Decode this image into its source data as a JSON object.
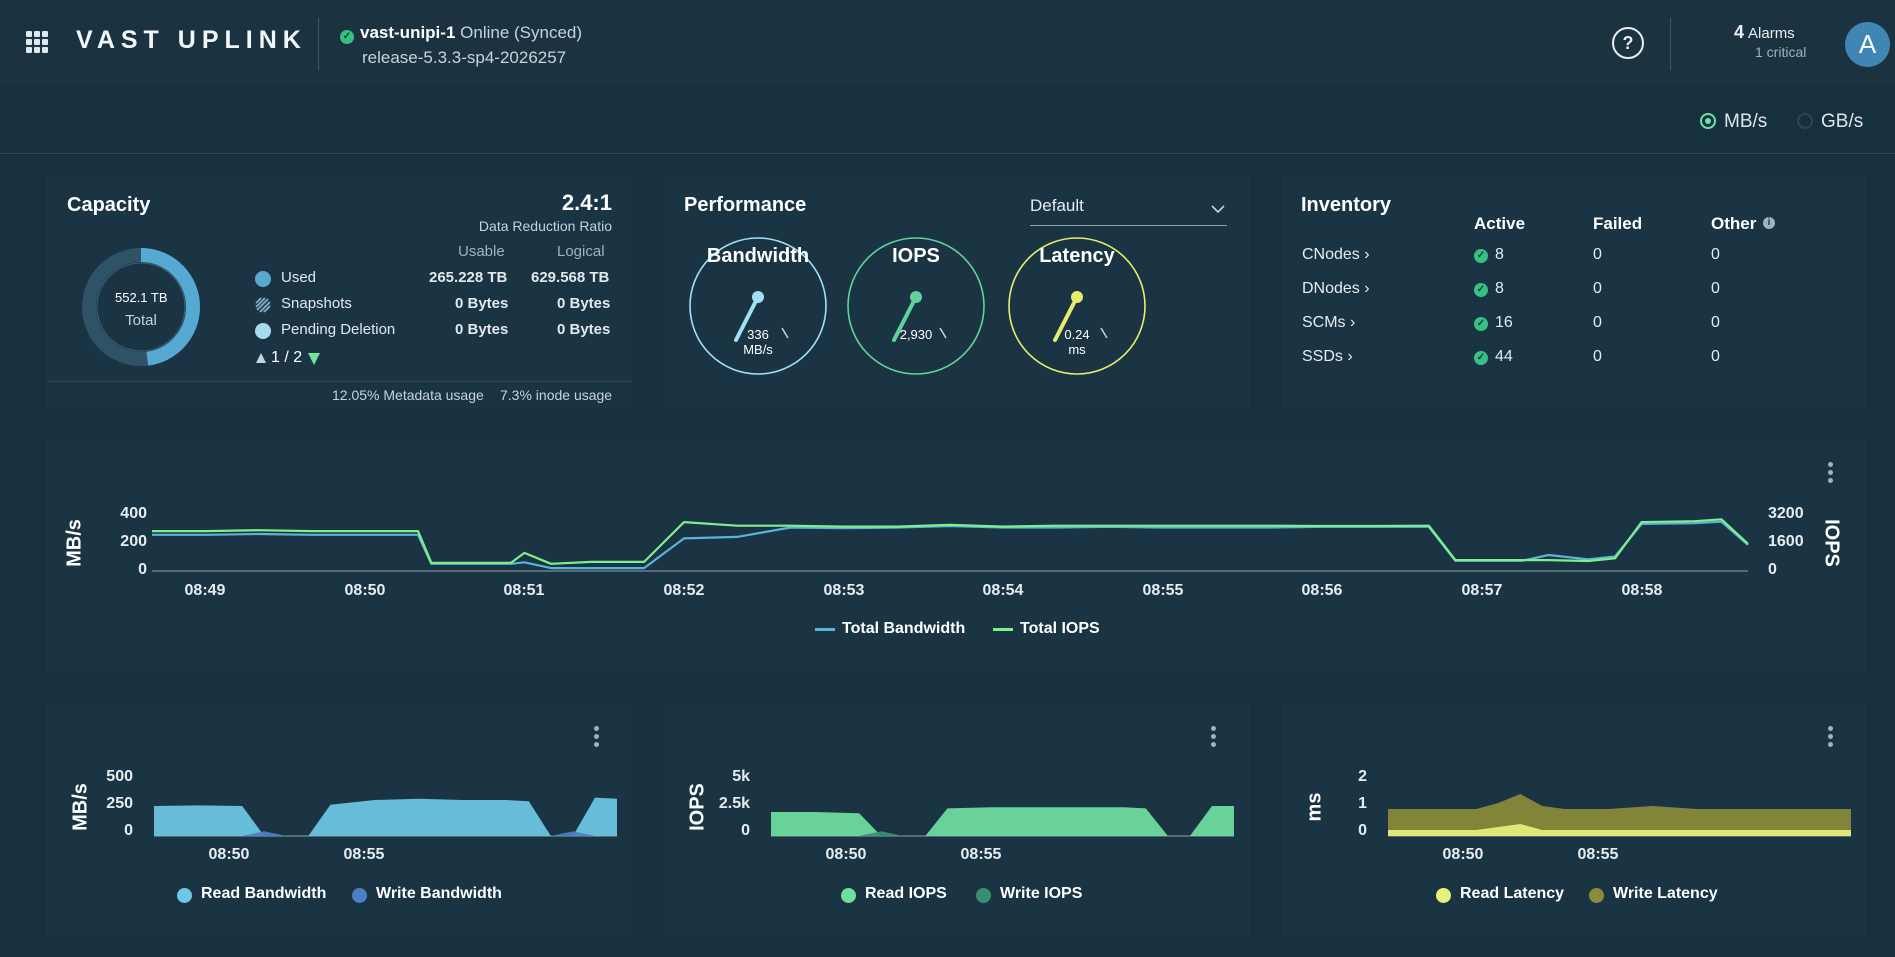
{
  "header": {
    "logo": "VAST UPLINK",
    "system_name": "vast-unipi-1",
    "system_state": "Online (Synced)",
    "release": "release-5.3.3-sp4-2026257",
    "help_label": "?",
    "alarm_count": "4",
    "alarm_label": "Alarms",
    "alarm_critical": "1 critical",
    "avatar": "A"
  },
  "units": {
    "option_mbs": "MB/s",
    "option_gbs": "GB/s",
    "selected": "MB/s"
  },
  "capacity": {
    "title": "Capacity",
    "total_value": "552.1 TB",
    "total_label": "Total",
    "drr_value": "2.4:1",
    "drr_label": "Data Reduction Ratio",
    "col_usable": "Usable",
    "col_logical": "Logical",
    "rows": [
      {
        "label": "Used",
        "usable": "265.228 TB",
        "logical": "629.568 TB"
      },
      {
        "label": "Snapshots",
        "usable": "0 Bytes",
        "logical": "0 Bytes"
      },
      {
        "label": "Pending Deletion",
        "usable": "0 Bytes",
        "logical": "0 Bytes"
      }
    ],
    "pager": "1 / 2",
    "metadata_usage": "12.05% Metadata usage",
    "inode_usage": "7.3% inode usage",
    "used_fraction": 0.48
  },
  "performance": {
    "title": "Performance",
    "dropdown_value": "Default",
    "gauges": [
      {
        "label": "Bandwidth",
        "value": "336",
        "unit": "MB/s",
        "color": "#9fe0f5"
      },
      {
        "label": "IOPS",
        "value": "2,930",
        "unit": "",
        "color": "#5fd39a"
      },
      {
        "label": "Latency",
        "value": "0.24",
        "unit": "ms",
        "color": "#e4ee6c"
      }
    ]
  },
  "inventory": {
    "title": "Inventory",
    "headers": [
      "Active",
      "Failed",
      "Other"
    ],
    "rows": [
      {
        "name": "CNodes ›",
        "active": "8",
        "failed": "0",
        "other": "0"
      },
      {
        "name": "DNodes ›",
        "active": "8",
        "failed": "0",
        "other": "0"
      },
      {
        "name": "SCMs ›",
        "active": "16",
        "failed": "0",
        "other": "0"
      },
      {
        "name": "SSDs ›",
        "active": "44",
        "failed": "0",
        "other": "0"
      }
    ]
  },
  "main_chart": {
    "ylabel_left": "MB/s",
    "ylabel_right": "IOPS",
    "yticks_left": [
      "400",
      "200",
      "0"
    ],
    "yticks_right": [
      "3200",
      "1600",
      "0"
    ],
    "xticks": [
      "08:49",
      "08:50",
      "08:51",
      "08:52",
      "08:53",
      "08:54",
      "08:55",
      "08:56",
      "08:57",
      "08:58"
    ],
    "legend": [
      "Total Bandwidth",
      "Total IOPS"
    ],
    "colors": {
      "bandwidth": "#5ab4d6",
      "iops": "#7ef08a"
    }
  },
  "small_charts": [
    {
      "ylabel": "MB/s",
      "yticks": [
        "500",
        "250",
        "0"
      ],
      "xticks": [
        "08:50",
        "08:55"
      ],
      "legend": [
        "Read Bandwidth",
        "Write Bandwidth"
      ],
      "colors": [
        "#6dc8e6",
        "#4d7fc4"
      ]
    },
    {
      "ylabel": "IOPS",
      "yticks": [
        "5k",
        "2.5k",
        "0"
      ],
      "xticks": [
        "08:50",
        "08:55"
      ],
      "legend": [
        "Read IOPS",
        "Write IOPS"
      ],
      "colors": [
        "#6fe0a0",
        "#3a8f72"
      ]
    },
    {
      "ylabel": "ms",
      "yticks": [
        "2",
        "1",
        "0"
      ],
      "xticks": [
        "08:50",
        "08:55"
      ],
      "legend": [
        "Read Latency",
        "Write Latency"
      ],
      "colors": [
        "#e9f07a",
        "#8b8b3a"
      ]
    }
  ],
  "chart_data": [
    {
      "type": "line",
      "x": [
        "08:48:40",
        "08:49:00",
        "08:49:20",
        "08:49:40",
        "08:50:00",
        "08:50:20",
        "08:50:25",
        "08:50:40",
        "08:50:55",
        "08:51:00",
        "08:51:10",
        "08:51:25",
        "08:51:35",
        "08:51:45",
        "08:52:00",
        "08:52:20",
        "08:52:40",
        "08:53:00",
        "08:53:20",
        "08:53:40",
        "08:54:00",
        "08:54:20",
        "08:54:40",
        "08:55:00",
        "08:55:20",
        "08:55:40",
        "08:56:00",
        "08:56:20",
        "08:56:40",
        "08:56:50",
        "08:57:00",
        "08:57:15",
        "08:57:25",
        "08:57:40",
        "08:57:50",
        "08:58:00",
        "08:58:20",
        "08:58:30",
        "08:58:40"
      ],
      "series": [
        {
          "name": "Total Bandwidth",
          "axis": "left",
          "values": [
            250,
            250,
            255,
            250,
            250,
            250,
            50,
            50,
            50,
            60,
            20,
            20,
            20,
            20,
            225,
            235,
            300,
            295,
            300,
            310,
            300,
            300,
            305,
            300,
            300,
            300,
            305,
            305,
            305,
            70,
            70,
            70,
            110,
            80,
            100,
            325,
            330,
            340,
            180
          ]
        },
        {
          "name": "Total IOPS",
          "axis": "right",
          "values": [
            2200,
            2200,
            2250,
            2200,
            2200,
            2200,
            450,
            450,
            450,
            1000,
            400,
            500,
            500,
            500,
            2700,
            2500,
            2500,
            2450,
            2450,
            2550,
            2450,
            2500,
            2500,
            2500,
            2500,
            2500,
            2480,
            2480,
            2500,
            600,
            600,
            600,
            600,
            550,
            700,
            2700,
            2750,
            2850,
            1500
          ]
        }
      ],
      "ylim_left": [
        0,
        400
      ],
      "ylim_right": [
        0,
        3200
      ],
      "ylabel": "MB/s",
      "ylabel_right": "IOPS",
      "grid": false,
      "legend": "bottom"
    },
    {
      "type": "area",
      "x": [
        "08:48",
        "08:49",
        "08:50",
        "08:50:30",
        "08:51",
        "08:51:30",
        "08:52",
        "08:53",
        "08:54",
        "08:55",
        "08:56",
        "08:56:30",
        "08:57",
        "08:57:30",
        "08:58",
        "08:58:30"
      ],
      "series": [
        {
          "name": "Read Bandwidth",
          "values": [
            250,
            255,
            250,
            0,
            0,
            0,
            260,
            300,
            310,
            300,
            300,
            290,
            0,
            0,
            320,
            310
          ]
        },
        {
          "name": "Write Bandwidth",
          "values": [
            0,
            0,
            0,
            40,
            0,
            0,
            0,
            0,
            0,
            0,
            0,
            0,
            0,
            40,
            0,
            0
          ]
        }
      ],
      "ylim": [
        0,
        500
      ],
      "ylabel": "MB/s"
    },
    {
      "type": "area",
      "x": [
        "08:48",
        "08:49",
        "08:50",
        "08:50:30",
        "08:51",
        "08:51:30",
        "08:52",
        "08:53",
        "08:54",
        "08:55",
        "08:56",
        "08:56:30",
        "08:57",
        "08:57:30",
        "08:58",
        "08:58:30"
      ],
      "series": [
        {
          "name": "Read IOPS",
          "values": [
            2000,
            2000,
            1900,
            0,
            0,
            0,
            2300,
            2400,
            2400,
            2400,
            2400,
            2300,
            0,
            0,
            2500,
            2500
          ]
        },
        {
          "name": "Write IOPS",
          "values": [
            0,
            0,
            0,
            400,
            0,
            0,
            0,
            0,
            0,
            0,
            0,
            0,
            0,
            0,
            0,
            0
          ]
        }
      ],
      "ylim": [
        0,
        5000
      ],
      "ylabel": "IOPS"
    },
    {
      "type": "area",
      "x": [
        "08:48",
        "08:49",
        "08:50",
        "08:50:30",
        "08:51",
        "08:51:30",
        "08:52",
        "08:53",
        "08:54",
        "08:55",
        "08:56",
        "08:56:30",
        "08:57",
        "08:57:30",
        "08:58",
        "08:58:30"
      ],
      "series": [
        {
          "name": "Write Latency",
          "values": [
            0.9,
            0.9,
            0.9,
            1.1,
            1.4,
            1.0,
            0.9,
            0.9,
            1.0,
            0.9,
            0.9,
            0.9,
            0.9,
            0.9,
            0.9,
            0.9
          ]
        },
        {
          "name": "Read Latency",
          "values": [
            0.2,
            0.2,
            0.2,
            0.3,
            0.4,
            0.2,
            0.2,
            0.2,
            0.2,
            0.2,
            0.2,
            0.2,
            0.2,
            0.2,
            0.2,
            0.2
          ]
        }
      ],
      "ylim": [
        0,
        2
      ],
      "ylabel": "ms"
    }
  ]
}
